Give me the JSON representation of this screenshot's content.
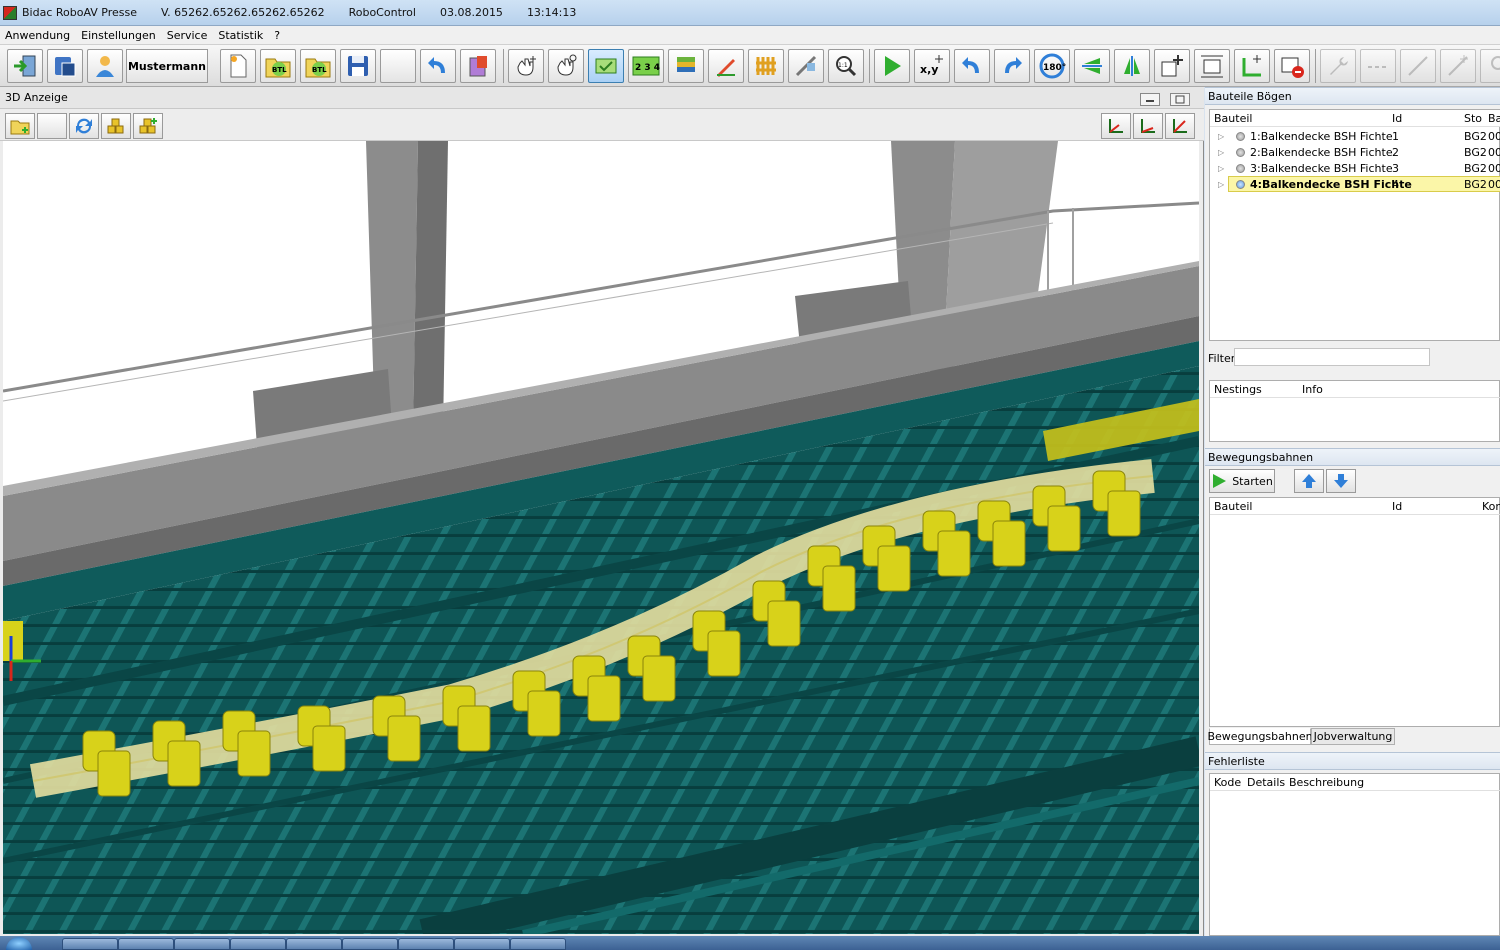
{
  "titlebar": {
    "app_name": "Bidac RoboAV Presse",
    "version": "V. 65262.65262.65262.65262",
    "module": "RoboControl",
    "date": "03.08.2015",
    "time": "13:14:13"
  },
  "menu": {
    "items": [
      "Anwendung",
      "Einstellungen",
      "Service",
      "Statistik",
      "?"
    ]
  },
  "toolbar": {
    "user_name": "Mustermann",
    "btl_label": "BTL",
    "numbers_label": "2 3 4",
    "xy_label": "x,y",
    "rotate_label": "180°",
    "scale_label": "1:1"
  },
  "panel3d": {
    "title": "3D Anzeige"
  },
  "bauteile": {
    "title": "Bauteile Bögen",
    "columns": [
      "Bauteil",
      "Id",
      "Sto",
      "Ba"
    ],
    "rows": [
      {
        "name": "1:Balkendecke BSH Fichte",
        "id": "1",
        "sto": "BG2",
        "ba": "00",
        "selected": false
      },
      {
        "name": "2:Balkendecke BSH Fichte",
        "id": "2",
        "sto": "BG2",
        "ba": "00",
        "selected": false
      },
      {
        "name": "3:Balkendecke BSH Fichte",
        "id": "3",
        "sto": "BG2",
        "ba": "00",
        "selected": false
      },
      {
        "name": "4:Balkendecke BSH Fichte",
        "id": "4",
        "sto": "BG2",
        "ba": "00",
        "selected": true
      }
    ]
  },
  "filter": {
    "label": "Filter:",
    "value": ""
  },
  "nestings": {
    "columns": [
      "Nestings",
      "Info"
    ]
  },
  "bewegungsbahnen": {
    "title": "Bewegungsbahnen",
    "start_label": "Starten",
    "columns": [
      "Bauteil",
      "Id",
      "Kon"
    ],
    "tabs": [
      "Bewegungsbahnen",
      "Jobverwaltung"
    ]
  },
  "fehlerliste": {
    "title": "Fehlerliste",
    "columns": [
      "Kode",
      "Details",
      "Beschreibung"
    ]
  },
  "colors": {
    "rail_teal": "#0f5b5b",
    "clamp_yellow": "#d8d21a",
    "beam_grey": "#8c8c8c",
    "selected_row": "#fbf6a8"
  }
}
